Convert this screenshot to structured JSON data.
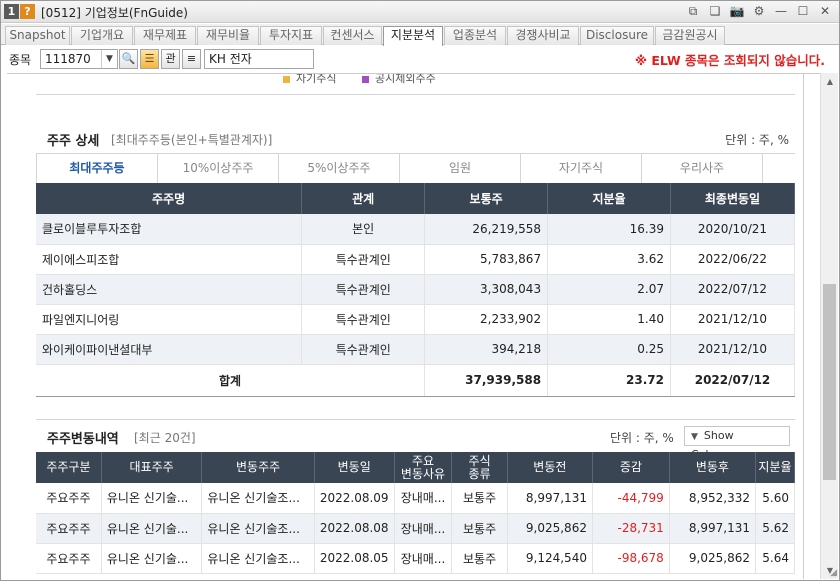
{
  "window": {
    "num": "1",
    "help": "?",
    "title": "[0512] 기업정보(FnGuide)"
  },
  "title_controls": [
    "⧉",
    "❏",
    "📷",
    "⚙",
    "—",
    "☐",
    "✕"
  ],
  "tabs": [
    "Snapshot",
    "기업개요",
    "재무제표",
    "재무비율",
    "투자지표",
    "컨센서스",
    "지분분석",
    "업종분석",
    "경쟁사비교",
    "Disclosure",
    "금감원공시"
  ],
  "search": {
    "label": "종목",
    "code": "111870",
    "name": "KH 전자",
    "btn_search": "🔍",
    "btn_fav": "☰",
    "btn_kwan": "관",
    "btn_stack": "≡",
    "warning": "※ ELW 종목은 조회되지 않습니다."
  },
  "legend_fragment": [
    "자기주식",
    "공시제외주주"
  ],
  "colors": {
    "accent": "#1f5aa8",
    "header": "#3a4554",
    "warning": "#e21f1f",
    "legend1": "#f0b33c",
    "legend2": "#a04fc0"
  },
  "holders": {
    "title": "주주 상세",
    "subtitle": "[최대주주등(본인+특별관계자)]",
    "unit": "단위 : 주, %",
    "tabs": [
      "최대주주등",
      "10%이상주주",
      "5%이상주주",
      "임원",
      "자기주식",
      "우리사주"
    ],
    "headers": [
      "주주명",
      "관계",
      "보통주",
      "지분율",
      "최종변동일"
    ],
    "rows": [
      [
        "클로이블루투자조합",
        "본인",
        "26,219,558",
        "16.39",
        "2020/10/21"
      ],
      [
        "제이에스피조합",
        "특수관계인",
        "5,783,867",
        "3.62",
        "2022/06/22"
      ],
      [
        "건하홀딩스",
        "특수관계인",
        "3,308,043",
        "2.07",
        "2022/07/12"
      ],
      [
        "파일엔지니어링",
        "특수관계인",
        "2,233,902",
        "1.40",
        "2021/12/10"
      ],
      [
        "와이케이파이낸셜대부",
        "특수관계인",
        "394,218",
        "0.25",
        "2021/12/10"
      ]
    ],
    "total": [
      "합계",
      "37,939,588",
      "23.72",
      "2022/07/12"
    ]
  },
  "changes": {
    "title": "주주변동내역",
    "subtitle": "[최근 20건]",
    "unit": "단위 : 주, %",
    "show_columns": "Show Columns",
    "headers": [
      "주주구분",
      "대표주주",
      "변동주주",
      "변동일",
      "주요\n변동사유",
      "주식\n종류",
      "변동전",
      "증감",
      "변동후",
      "지분율"
    ],
    "rows": [
      [
        "주요주주",
        "유니온 신기술...",
        "유니온 신기술조...",
        "2022.08.09",
        "장내매...",
        "보통주",
        "8,997,131",
        "-44,799",
        "8,952,332",
        "5.60"
      ],
      [
        "주요주주",
        "유니온 신기술...",
        "유니온 신기술조...",
        "2022.08.08",
        "장내매...",
        "보통주",
        "9,025,862",
        "-28,731",
        "8,997,131",
        "5.62"
      ],
      [
        "주요주주",
        "유니온 신기술...",
        "유니온 신기술조...",
        "2022.08.05",
        "장내매...",
        "보통주",
        "9,124,540",
        "-98,678",
        "9,025,862",
        "5.64"
      ]
    ]
  }
}
